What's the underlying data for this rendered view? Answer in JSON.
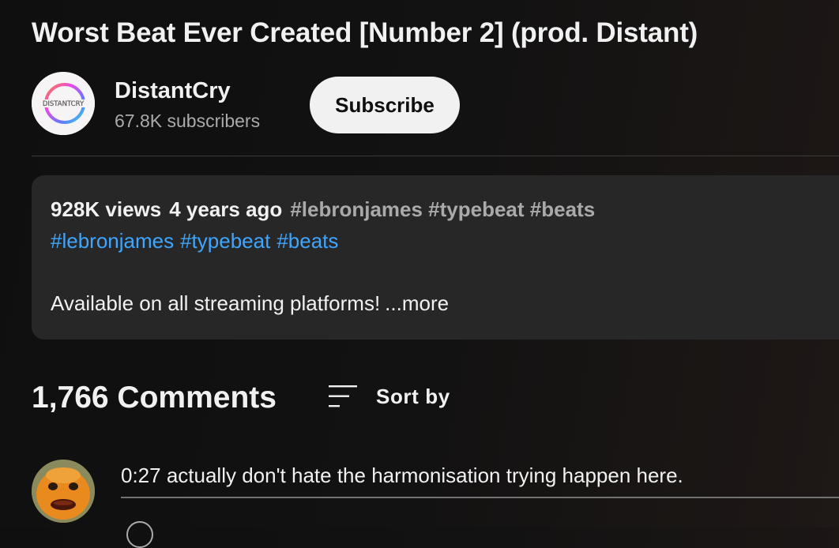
{
  "video": {
    "title": "Worst Beat Ever Created [Number 2] (prod. Distant)"
  },
  "channel": {
    "name": "DistantCry",
    "subscribers": "67.8K subscribers",
    "logo_text": "DISTANTCRY",
    "subscribe_label": "Subscribe"
  },
  "description": {
    "views": "928K views",
    "age": "4 years ago",
    "header_tags": "#lebronjames #typebeat #beats",
    "tags": [
      "#lebronjames",
      "#typebeat",
      "#beats"
    ],
    "text": "Available on all streaming platforms!",
    "more_label": "...more"
  },
  "comments": {
    "count_label": "1,766 Comments",
    "sort_label": "Sort by",
    "items": [
      {
        "text": "0:27 actually don't hate the harmonisation trying happen here."
      }
    ]
  },
  "colors": {
    "background": "#0f0f0f",
    "description_bg": "#272727",
    "link": "#3ea6ff",
    "subscribe_bg": "#f1f1f1"
  },
  "icons": {
    "sort": "sort-lines-icon",
    "channel_avatar": "distantcry-logo",
    "comment_avatar": "orange-face-avatar"
  }
}
